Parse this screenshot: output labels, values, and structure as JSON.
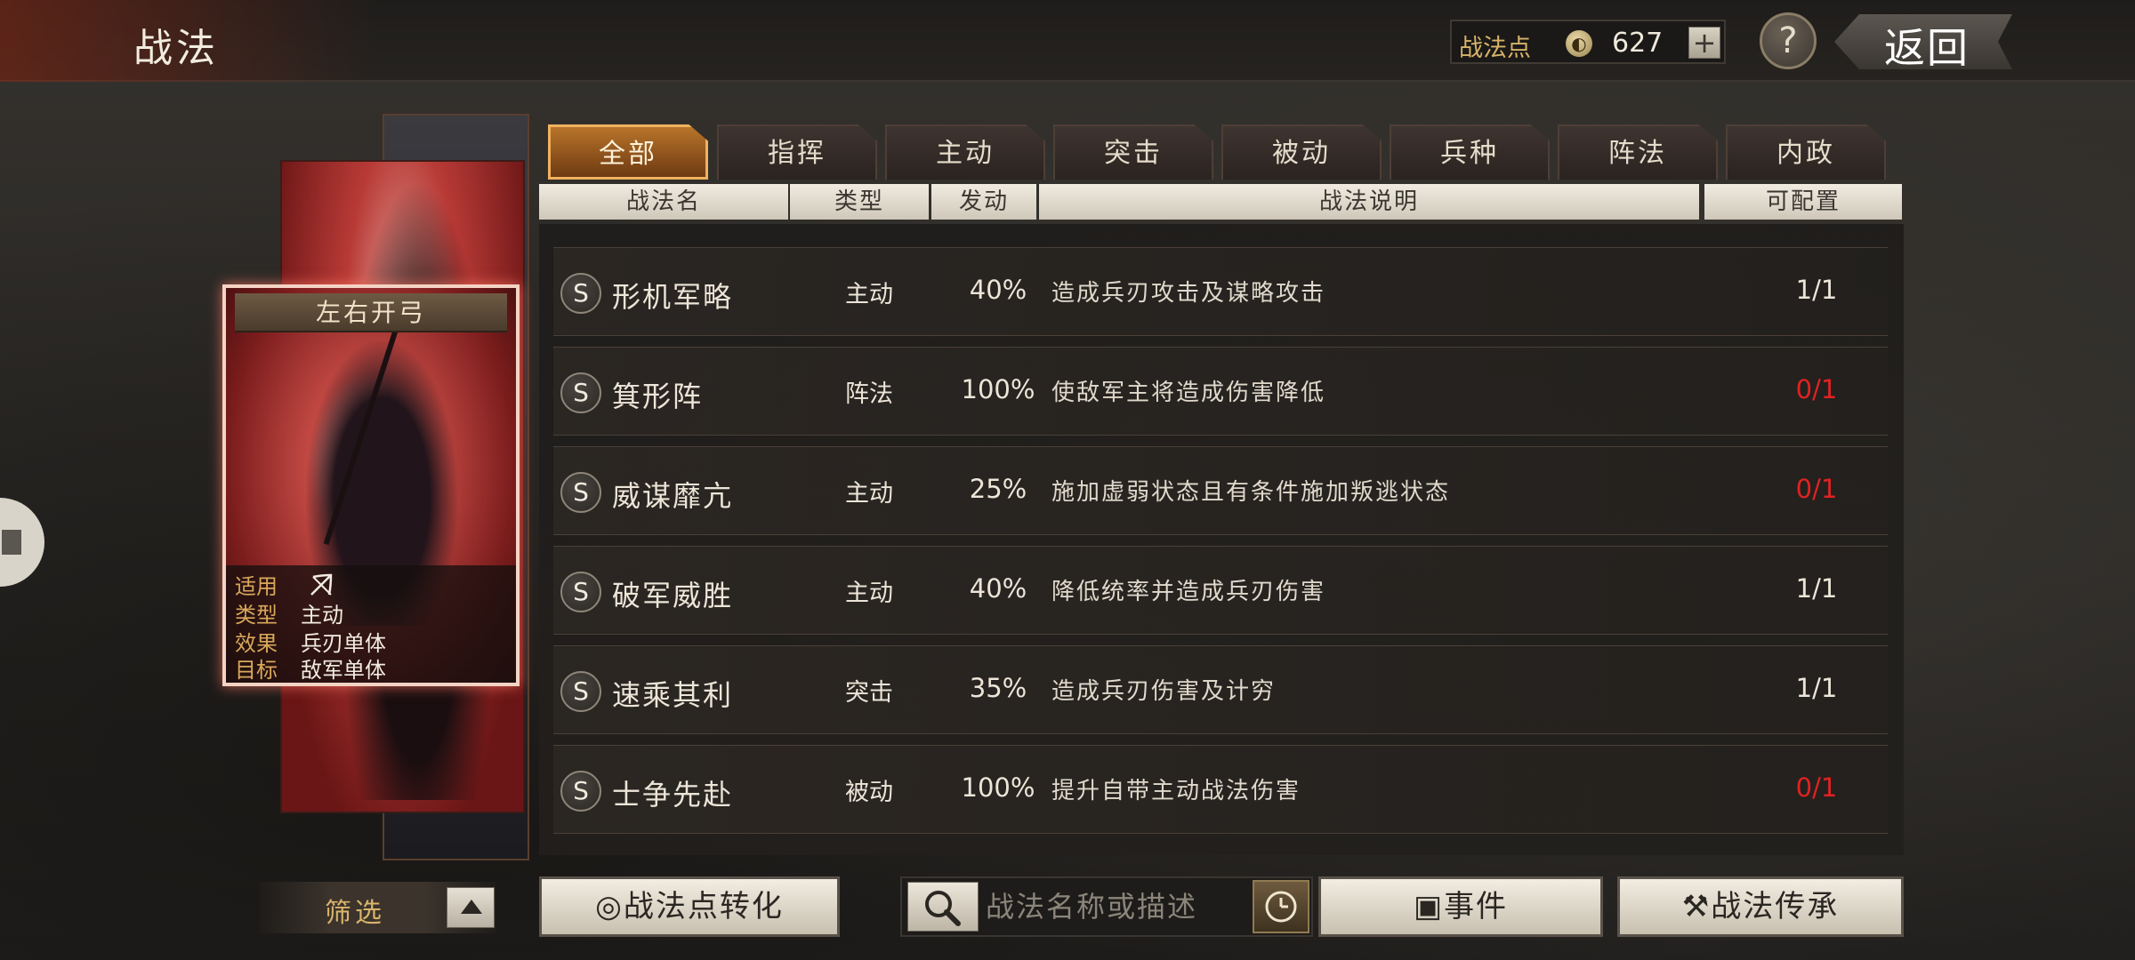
{
  "header": {
    "title": "战法",
    "points_label": "战法点",
    "points_value": "627",
    "plus_label": "+",
    "help_label": "?",
    "back_label": "返回"
  },
  "tabs": [
    {
      "label": "全部",
      "active": true
    },
    {
      "label": "指挥"
    },
    {
      "label": "主动"
    },
    {
      "label": "突击"
    },
    {
      "label": "被动"
    },
    {
      "label": "兵种"
    },
    {
      "label": "阵法"
    },
    {
      "label": "内政"
    }
  ],
  "columns": {
    "name": "战法名",
    "type": "类型",
    "rate": "发动",
    "desc": "战法说明",
    "config": "可配置"
  },
  "rows": [
    {
      "grade": "S",
      "name": "形机军略",
      "type": "主动",
      "rate": "40%",
      "desc": "造成兵刃攻击及谋略攻击",
      "config": "1/1",
      "config_red": false
    },
    {
      "grade": "S",
      "name": "箕形阵",
      "type": "阵法",
      "rate": "100%",
      "desc": "使敌军主将造成伤害降低",
      "config": "0/1",
      "config_red": true
    },
    {
      "grade": "S",
      "name": "威谋靡亢",
      "type": "主动",
      "rate": "25%",
      "desc": "施加虚弱状态且有条件施加叛逃状态",
      "config": "0/1",
      "config_red": true
    },
    {
      "grade": "S",
      "name": "破军威胜",
      "type": "主动",
      "rate": "40%",
      "desc": "降低统率并造成兵刃伤害",
      "config": "1/1",
      "config_red": false
    },
    {
      "grade": "S",
      "name": "速乘其利",
      "type": "突击",
      "rate": "35%",
      "desc": "造成兵刃伤害及计穷",
      "config": "1/1",
      "config_red": false
    },
    {
      "grade": "S",
      "name": "士争先赴",
      "type": "被动",
      "rate": "100%",
      "desc": "提升自带主动战法伤害",
      "config": "0/1",
      "config_red": true
    }
  ],
  "selected_card": {
    "title": "左右开弓",
    "fields": [
      {
        "key": "适用",
        "value": ""
      },
      {
        "key": "类型",
        "value": "主动"
      },
      {
        "key": "效果",
        "value": "兵刃单体"
      },
      {
        "key": "目标",
        "value": "敌军单体"
      }
    ]
  },
  "bottom": {
    "filter_label": "筛选",
    "convert_label": "战法点转化",
    "search_placeholder": "战法名称或描述",
    "event_label": "事件",
    "inherit_label": "战法传承"
  },
  "colors": {
    "accent_gold": "#d9b46a",
    "config_red": "#e02222",
    "tab_active": "#f0b160"
  }
}
